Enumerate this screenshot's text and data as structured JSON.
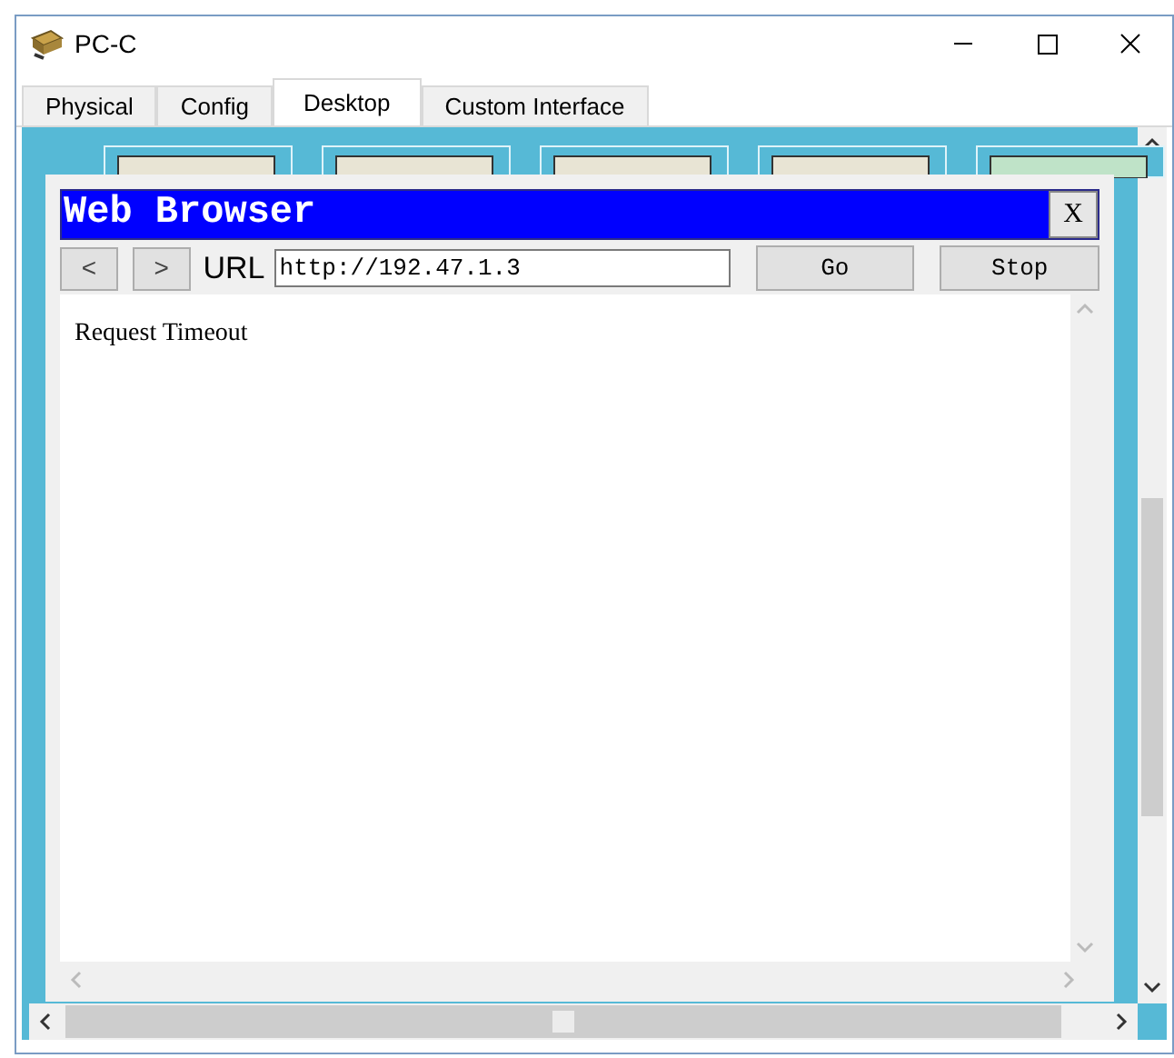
{
  "window": {
    "title": "PC-C"
  },
  "tabs": [
    {
      "label": "Physical",
      "selected": false
    },
    {
      "label": "Config",
      "selected": false
    },
    {
      "label": "Desktop",
      "selected": true
    },
    {
      "label": "Custom Interface",
      "selected": false
    }
  ],
  "browser": {
    "title": "Web Browser",
    "close": "X",
    "back": "<",
    "forward": ">",
    "url_label": "URL",
    "url": "http://192.47.1.3",
    "go": "Go",
    "stop": "Stop",
    "content": "Request Timeout"
  }
}
